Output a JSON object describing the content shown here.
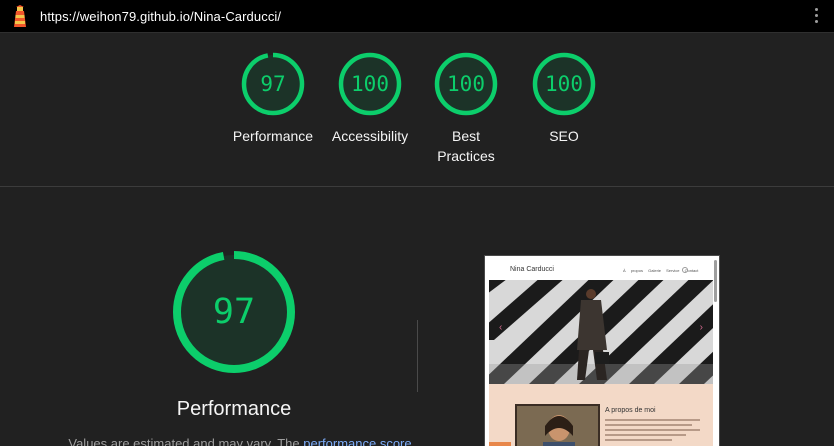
{
  "header": {
    "url": "https://weihon79.github.io/Nina-Carducci/",
    "logo_icon": "lighthouse-icon",
    "menu_icon": "more-vertical-icon"
  },
  "colors": {
    "pass": "#0cce6b",
    "pass_fill": "#1c3328",
    "link": "#7cacf8"
  },
  "categories": [
    {
      "score": "97",
      "score_value": 97,
      "label": "Performance"
    },
    {
      "score": "100",
      "score_value": 100,
      "label": "Accessibility"
    },
    {
      "score": "100",
      "score_value": 100,
      "label": "Best Practices"
    },
    {
      "score": "100",
      "score_value": 100,
      "label": "SEO"
    }
  ],
  "performance": {
    "score": "97",
    "score_value": 97,
    "title": "Performance",
    "note_prefix": "Values are estimated and may vary. The",
    "note_link": "performance score"
  },
  "screenshot": {
    "brand": "Nina Carducci",
    "nav": "À propos Galerie Service Contact",
    "about_title": "A propos de moi"
  }
}
